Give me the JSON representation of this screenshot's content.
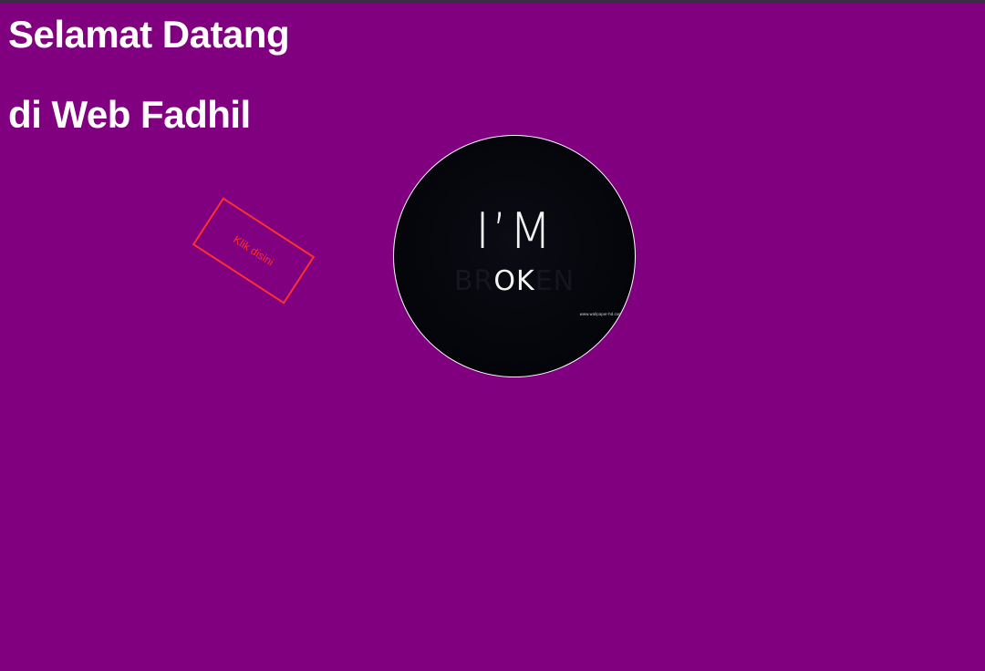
{
  "page": {
    "background_color": "#800080",
    "heading_line_1": "Selamat Datang",
    "heading_line_2": "di Web Fadhil"
  },
  "button": {
    "label": "Klik disini",
    "color": "#ff3030"
  },
  "profile_image": {
    "text_top": "I’M",
    "text_bottom_prefix": "BR",
    "text_bottom_highlight": "OK",
    "text_bottom_suffix": "EN",
    "watermark": "www.wallpaper-hd.com"
  }
}
